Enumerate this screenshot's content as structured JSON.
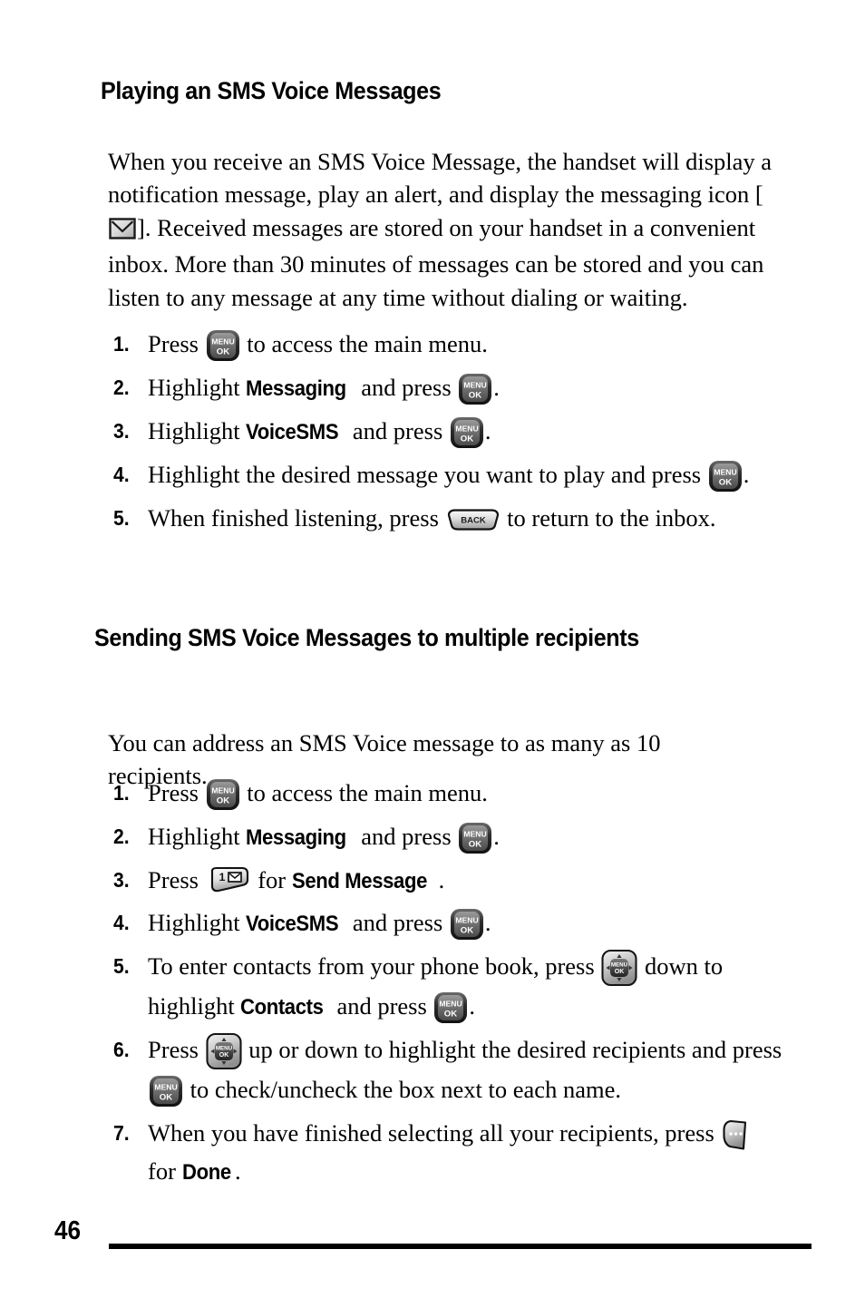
{
  "page": {
    "number": "46"
  },
  "sections": [
    {
      "heading": "Playing an SMS Voice Messages",
      "intro_parts": [
        "When you receive an SMS Voice Message, the handset will display a notification message, play an alert, and display the messaging icon [",
        "]. Received messages are stored on your handset in a convenient inbox. More than 30 minutes of messages can be stored and you can listen to any message at any time without dialing or waiting."
      ],
      "steps": [
        {
          "num": "1.",
          "pre": "Press ",
          "icon": "menu-ok-key",
          "post": " to access the main menu."
        },
        {
          "num": "2.",
          "pre": "Highlight ",
          "keyword": "Messaging",
          "mid": " and press ",
          "icon": "menu-ok-key",
          "post": "."
        },
        {
          "num": "3.",
          "pre": "Highlight ",
          "keyword": "VoiceSMS",
          "mid": " and press ",
          "icon": "menu-ok-key",
          "post": "."
        },
        {
          "num": "4.",
          "pre": "Highlight the desired message you want to play and press ",
          "icon": "menu-ok-key",
          "post": "."
        },
        {
          "num": "5.",
          "pre": "When finished listening, press ",
          "icon": "back-key",
          "post": " to return to the inbox."
        }
      ]
    },
    {
      "heading": "Sending SMS Voice Messages to multiple recipients",
      "intro": "You can address an SMS Voice message to as many as 10 recipients.",
      "steps": [
        {
          "num": "1.",
          "pre": "Press ",
          "icon": "menu-ok-key",
          "post": " to access the main menu."
        },
        {
          "num": "2.",
          "pre": "Highlight ",
          "keyword": "Messaging",
          "mid": " and press ",
          "icon": "menu-ok-key",
          "post": "."
        },
        {
          "num": "3.",
          "pre": "Press ",
          "icon": "one-message-key",
          "mid": " for ",
          "keyword": "Send Message",
          "post": "."
        },
        {
          "num": "4.",
          "pre": "Highlight ",
          "keyword": "VoiceSMS",
          "mid": " and press ",
          "icon": "menu-ok-key",
          "post": "."
        },
        {
          "num": "5.",
          "pre": "To enter contacts from your phone book, press ",
          "icon": "nav-pad-key",
          "mid": " down to highlight ",
          "keyword": "Contacts",
          "mid2": " and press ",
          "icon2": "menu-ok-key",
          "post": "."
        },
        {
          "num": "6.",
          "pre": "Press ",
          "icon": "nav-pad-key",
          "mid": " up or down to highlight the desired recipients and press ",
          "icon2": "menu-ok-key",
          "post": " to check/uncheck the box next to each name."
        },
        {
          "num": "7.",
          "pre": "When you have finished selecting all your recipients, press ",
          "icon": "soft-key",
          "mid": " for ",
          "keyword": "Done",
          "post": "."
        }
      ]
    }
  ],
  "icons": {
    "menu_ok_key": {
      "name": "menu-ok-key",
      "line1": "MENU",
      "line2": "OK"
    },
    "back_key": {
      "name": "back-key",
      "label": "BACK"
    },
    "one_message_key": {
      "name": "one-message-key",
      "label": "1"
    },
    "nav_pad_key": {
      "name": "nav-pad-key",
      "line1": "MENU",
      "line2": "OK"
    },
    "soft_key": {
      "name": "soft-key",
      "label": ""
    },
    "envelope": {
      "name": "envelope-icon"
    }
  },
  "colors": {
    "text": "#000000",
    "background": "#ffffff",
    "key_dark": "#3a3a3a",
    "key_light": "#d8d8d8"
  }
}
